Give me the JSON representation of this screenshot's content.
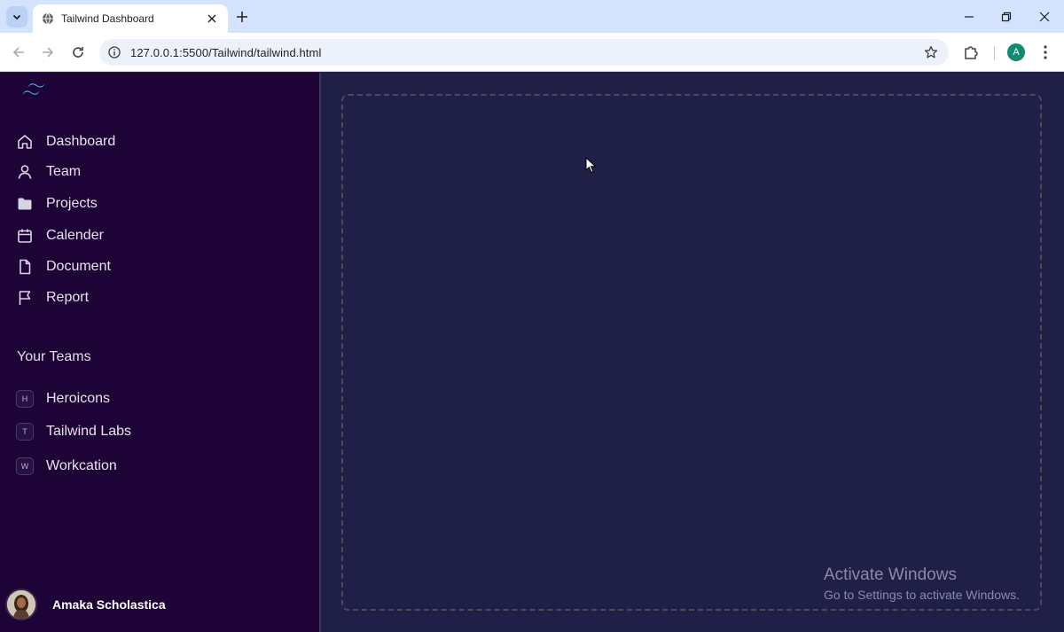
{
  "browser": {
    "tab_title": "Tailwind Dashboard",
    "url": "127.0.0.1:5500/Tailwind/tailwind.html",
    "profile_initial": "A"
  },
  "sidebar": {
    "nav": [
      {
        "label": "Dashboard",
        "icon": "home-icon"
      },
      {
        "label": "Team",
        "icon": "user-icon"
      },
      {
        "label": "Projects",
        "icon": "folder-icon"
      },
      {
        "label": "Calender",
        "icon": "calendar-icon"
      },
      {
        "label": "Document",
        "icon": "document-icon"
      },
      {
        "label": "Report",
        "icon": "flag-icon"
      }
    ],
    "teams_title": "Your Teams",
    "teams": [
      {
        "initial": "H",
        "label": "Heroicons"
      },
      {
        "initial": "T",
        "label": "Tailwind Labs"
      },
      {
        "initial": "W",
        "label": "Workcation"
      }
    ],
    "user_name": "Amaka Scholastica"
  },
  "watermark": {
    "title": "Activate Windows",
    "subtitle": "Go to Settings to activate Windows."
  },
  "colors": {
    "sidebar_bg": "#1e0436",
    "main_bg": "#1f1f47",
    "logo_accent": "#38bdf8",
    "chrome_tabbar": "#d3e3fd"
  }
}
